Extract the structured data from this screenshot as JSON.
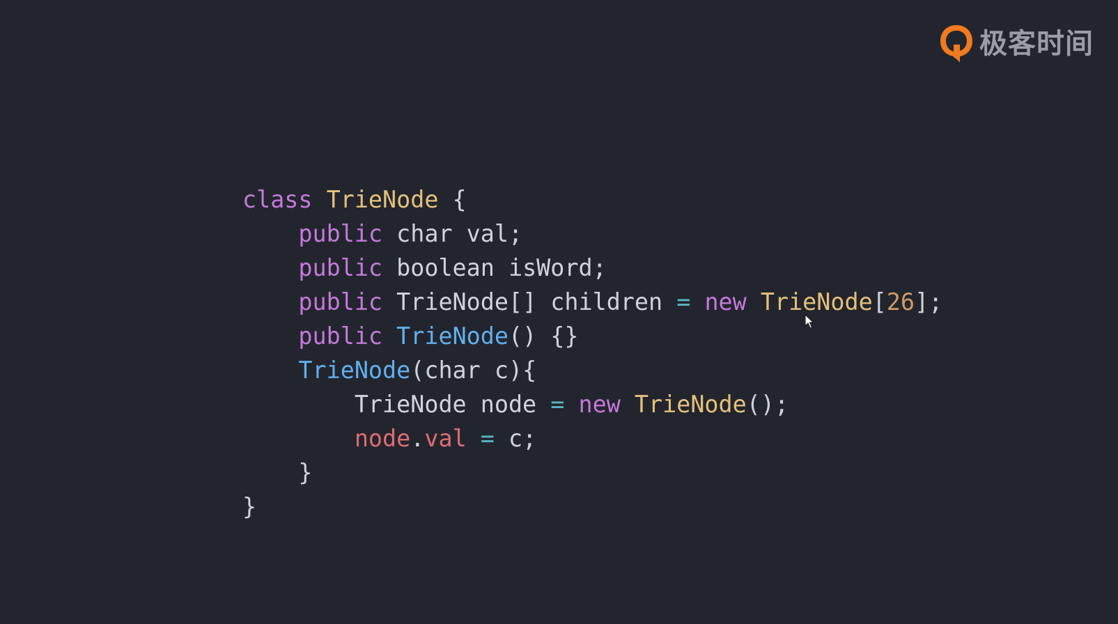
{
  "brand": {
    "name": "极客时间",
    "mark_icon": "geektime-logo-icon",
    "mark_color": "#f07a1f"
  },
  "code": {
    "language": "java",
    "lines": [
      {
        "indent": 0,
        "tokens": [
          {
            "text": "class",
            "role": "keyword"
          },
          {
            "text": " ",
            "role": "plain"
          },
          {
            "text": "TrieNode",
            "role": "type"
          },
          {
            "text": " {",
            "role": "plain"
          }
        ]
      },
      {
        "indent": 1,
        "tokens": [
          {
            "text": "public",
            "role": "keyword"
          },
          {
            "text": " char val;",
            "role": "plain"
          }
        ]
      },
      {
        "indent": 1,
        "tokens": [
          {
            "text": "public",
            "role": "keyword"
          },
          {
            "text": " boolean isWord;",
            "role": "plain"
          }
        ]
      },
      {
        "indent": 1,
        "tokens": [
          {
            "text": "public",
            "role": "keyword"
          },
          {
            "text": " TrieNode[] children ",
            "role": "plain"
          },
          {
            "text": "=",
            "role": "operator"
          },
          {
            "text": " ",
            "role": "plain"
          },
          {
            "text": "new",
            "role": "keyword"
          },
          {
            "text": " ",
            "role": "plain"
          },
          {
            "text": "TrieNode",
            "role": "type"
          },
          {
            "text": "[",
            "role": "plain"
          },
          {
            "text": "26",
            "role": "number"
          },
          {
            "text": "];",
            "role": "plain"
          }
        ]
      },
      {
        "indent": 1,
        "tokens": [
          {
            "text": "public",
            "role": "keyword"
          },
          {
            "text": " ",
            "role": "plain"
          },
          {
            "text": "TrieNode",
            "role": "function"
          },
          {
            "text": "() {}",
            "role": "plain"
          }
        ]
      },
      {
        "indent": 1,
        "tokens": [
          {
            "text": "TrieNode",
            "role": "function"
          },
          {
            "text": "(char c){",
            "role": "plain"
          }
        ]
      },
      {
        "indent": 2,
        "tokens": [
          {
            "text": "TrieNode node ",
            "role": "plain"
          },
          {
            "text": "=",
            "role": "operator"
          },
          {
            "text": " ",
            "role": "plain"
          },
          {
            "text": "new",
            "role": "keyword"
          },
          {
            "text": " ",
            "role": "plain"
          },
          {
            "text": "TrieNode",
            "role": "type"
          },
          {
            "text": "();",
            "role": "plain"
          }
        ]
      },
      {
        "indent": 2,
        "tokens": [
          {
            "text": "node",
            "role": "variable"
          },
          {
            "text": ".",
            "role": "plain"
          },
          {
            "text": "val",
            "role": "variable"
          },
          {
            "text": " ",
            "role": "plain"
          },
          {
            "text": "=",
            "role": "operator"
          },
          {
            "text": " c;",
            "role": "plain"
          }
        ]
      },
      {
        "indent": 1,
        "tokens": [
          {
            "text": "}",
            "role": "plain"
          }
        ]
      },
      {
        "indent": 0,
        "tokens": [
          {
            "text": "}",
            "role": "plain"
          }
        ]
      }
    ]
  },
  "theme": {
    "background": "#22252d",
    "keyword": "#c678dd",
    "type": "#e5c07b",
    "function": "#61afef",
    "operator": "#56b6c2",
    "number": "#d19a66",
    "variable": "#e06c75",
    "plain": "#cfd3da"
  },
  "cursor_icon": "mouse-pointer-icon"
}
